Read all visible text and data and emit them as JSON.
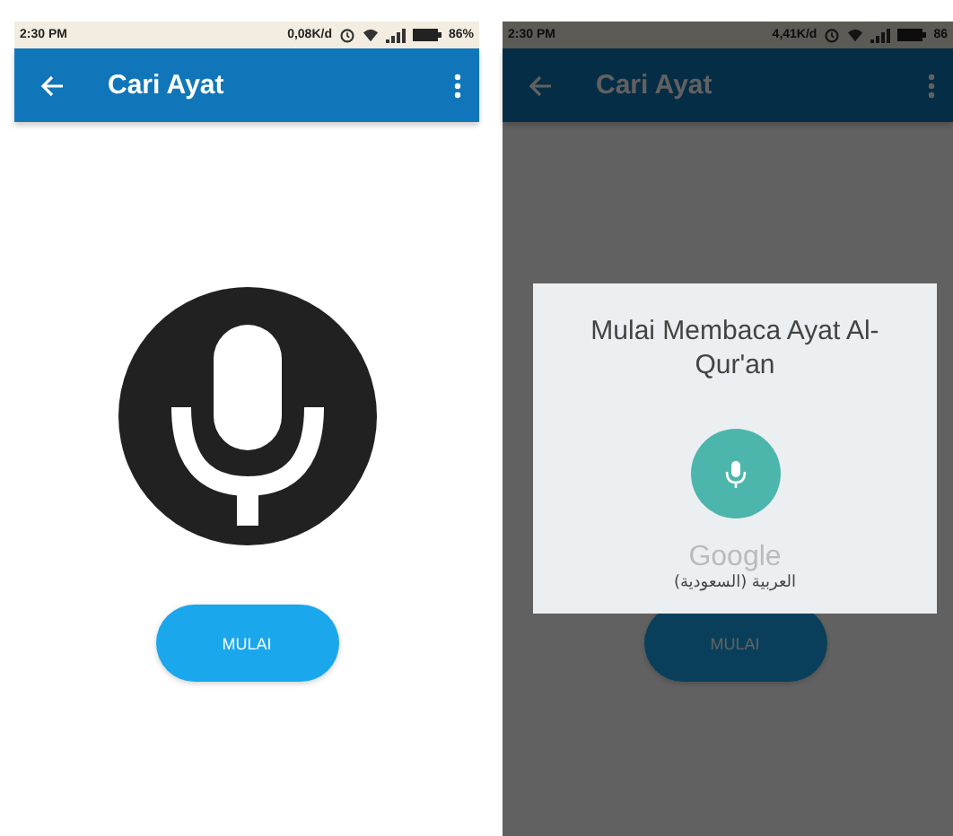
{
  "screens": [
    {
      "status_bar": {
        "time": "2:30 PM",
        "data_rate": "0,08K/d",
        "battery": "86%"
      },
      "app_bar": {
        "title": "Cari Ayat"
      },
      "start_button": "MULAI",
      "dimmed": false
    },
    {
      "status_bar": {
        "time": "2:30 PM",
        "data_rate": "4,41K/d",
        "battery": "86"
      },
      "app_bar": {
        "title": "Cari Ayat"
      },
      "start_button": "MULAI",
      "dimmed": true,
      "dialog": {
        "prompt": "Mulai Membaca Ayat Al-Qur'an",
        "brand": "Google",
        "language": "العربية (السعودية)"
      }
    }
  ]
}
